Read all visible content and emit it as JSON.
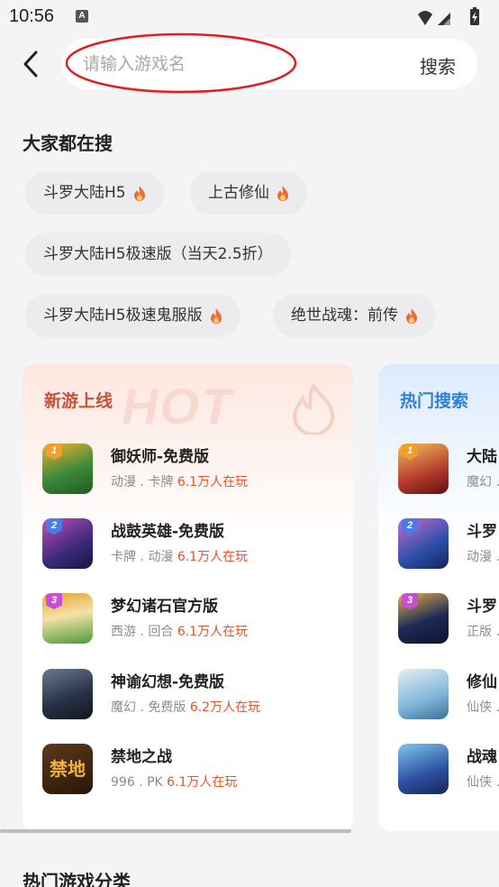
{
  "status_bar": {
    "time": "10:56",
    "notification_letter": "A"
  },
  "search": {
    "placeholder": "请输入游戏名",
    "value": "",
    "button_label": "搜索"
  },
  "popular": {
    "title": "大家都在搜",
    "chips": [
      {
        "label": "斗罗大陆H5",
        "hot": true
      },
      {
        "label": "上古修仙",
        "hot": true
      },
      {
        "label": "斗罗大陆H5极速版（当天2.5折）",
        "hot": false
      },
      {
        "label": "斗罗大陆H5极速鬼服版",
        "hot": true
      },
      {
        "label": "绝世战魂：前传",
        "hot": true
      }
    ]
  },
  "new_games": {
    "title": "新游上线",
    "watermark": "HOT",
    "items": [
      {
        "rank": "1",
        "name": "御妖师-免费版",
        "tags": "动漫 . 卡牌",
        "players": "6.1万人在玩",
        "icon": "yuyaoshi-game-icon",
        "colors": [
          "#2e7d32",
          "#f2b233"
        ]
      },
      {
        "rank": "2",
        "name": "战鼓英雄-免费版",
        "tags": "卡牌 . 动漫",
        "players": "6.1万人在玩",
        "icon": "zhangu-game-icon",
        "colors": [
          "#3a2a7a",
          "#c24fb8"
        ]
      },
      {
        "rank": "3",
        "name": "梦幻诸石官方版",
        "tags": "西游 . 回合",
        "players": "6.1万人在玩",
        "icon": "menghuan-game-icon",
        "colors": [
          "#e3a52b",
          "#4e9b3a"
        ]
      },
      {
        "rank": "",
        "name": "神谕幻想-免费版",
        "tags": "魔幻 . 免费版",
        "players": "6.2万人在玩",
        "icon": "shenyu-game-icon",
        "colors": [
          "#1f2a3c",
          "#6b7b92"
        ]
      },
      {
        "rank": "",
        "name": "禁地之战",
        "tags": "996 . PK",
        "players": "6.1万人在玩",
        "icon": "jindi-game-icon",
        "colors": [
          "#3a2410",
          "#e2a33a"
        ],
        "icon_text": "禁地"
      }
    ]
  },
  "hot_search": {
    "title": "热门搜索",
    "items": [
      {
        "rank": "1",
        "name": "大陆",
        "tags": "魔幻 .",
        "icon": "dalu-game-icon",
        "colors": [
          "#b43a2c",
          "#f2c15a"
        ]
      },
      {
        "rank": "2",
        "name": "斗罗",
        "tags": "动漫 .",
        "icon": "douluo-game-icon",
        "colors": [
          "#2a4fa8",
          "#c86bd0"
        ]
      },
      {
        "rank": "3",
        "name": "斗罗",
        "tags": "正版 .",
        "icon": "douluo2-game-icon",
        "colors": [
          "#1d2a55",
          "#e4b24a"
        ]
      },
      {
        "rank": "",
        "name": "修仙",
        "tags": "仙侠 .",
        "icon": "xiuxian-game-icon",
        "colors": [
          "#7fb6d8",
          "#e6eef5"
        ]
      },
      {
        "rank": "",
        "name": "战魂",
        "tags": "仙侠 .",
        "icon": "zhanhun-game-icon",
        "colors": [
          "#2c4fa0",
          "#7fc6ee"
        ]
      }
    ]
  },
  "categories": {
    "title": "热门游戏分类"
  },
  "colors": {
    "accent": "#e8532b",
    "rank1": "#f0a02a",
    "rank2": "#4c7be6",
    "rank3": "#c94fd0"
  }
}
